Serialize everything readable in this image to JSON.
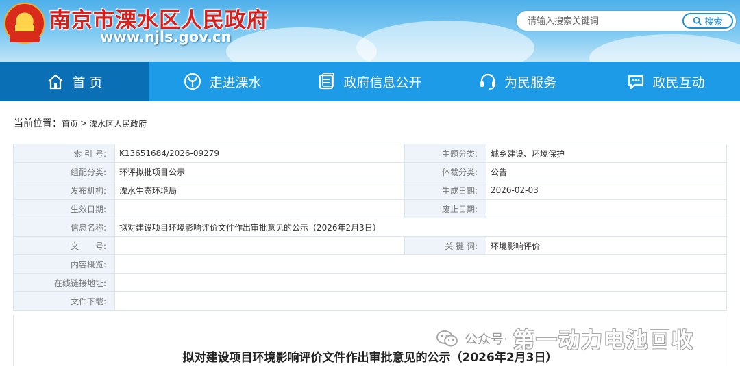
{
  "header": {
    "site_title": "南京市溧水区人民政府",
    "site_url": "www.njls.gov.cn",
    "emblem": "national-emblem",
    "search": {
      "placeholder": "请输入搜索关键词",
      "button_label": "搜索"
    }
  },
  "nav": {
    "items": [
      {
        "label": "首 页",
        "icon": "home-icon"
      },
      {
        "label": "走进溧水",
        "icon": "leaf-icon"
      },
      {
        "label": "政府信息公开",
        "icon": "document-icon"
      },
      {
        "label": "为民服务",
        "icon": "headset-icon"
      },
      {
        "label": "政民互动",
        "icon": "chat-icon"
      }
    ]
  },
  "breadcrumb": {
    "label": "当前位置：",
    "items": [
      "首页",
      "溧水区人民政府"
    ],
    "separator": ">"
  },
  "info": {
    "rows": [
      {
        "k1": "索 引 号:",
        "v1": "K13651684/2026-09279",
        "k2": "主题分类:",
        "v2": "城乡建设、环境保护"
      },
      {
        "k1": "组配分类:",
        "v1": "环评拟批项目公示",
        "k2": "体裁分类:",
        "v2": "公告"
      },
      {
        "k1": "发布机构:",
        "v1": "溧水生态环境局",
        "k2": "生成日期:",
        "v2": "2026-02-03"
      },
      {
        "k1": "生效日期:",
        "v1": "",
        "k2": "废止日期:",
        "v2": ""
      },
      {
        "k1": "信息名称:",
        "v1": "拟对建设项目环境影响评价文件作出审批意见的公示（2026年2月3日）"
      },
      {
        "k1": "文　　号:",
        "v1": "",
        "k2": "关 键 词:",
        "v2": "环境影响评价"
      },
      {
        "k1": "内容概览:",
        "v1": ""
      },
      {
        "k1": "在线链接地址:",
        "v1": ""
      },
      {
        "k1": "文件下载:",
        "v1": ""
      }
    ]
  },
  "content": {
    "title": "拟对建设项目环境影响评价文件作出审批意见的公示（2026年2月3日）"
  },
  "watermark": {
    "prefix": "公众号·",
    "name": "第一动力电池回收"
  },
  "colors": {
    "nav": "#1e9be6",
    "nav_active": "#0b6fb6",
    "title_red": "#d7201e",
    "key_bg": "#eef4fa"
  }
}
